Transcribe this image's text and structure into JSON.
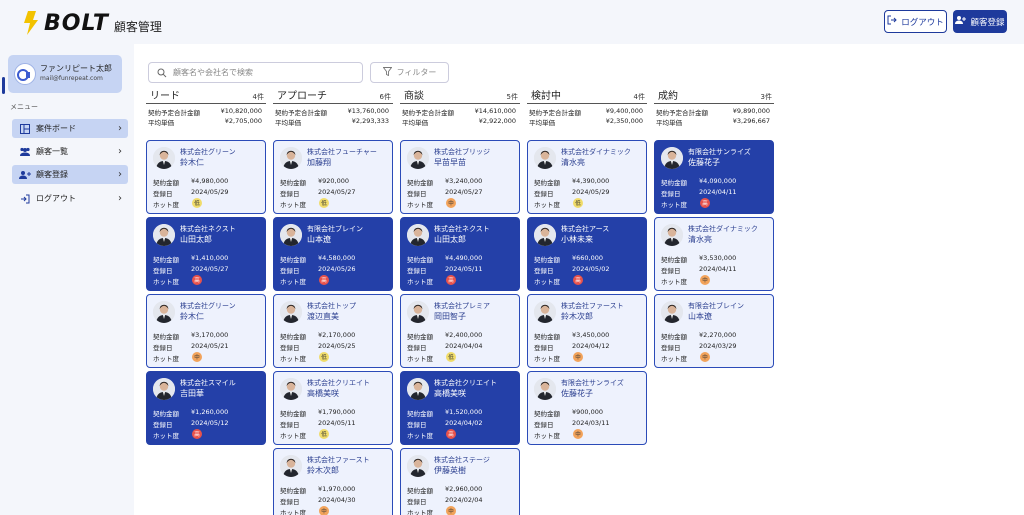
{
  "app": {
    "logo_text": "BOLT",
    "subtitle": "顧客管理"
  },
  "header": {
    "logout_label": "ログアウト",
    "register_label": "顧客登録"
  },
  "user": {
    "name": "ファンリピート太郎",
    "email": "mail@funrepeat.com"
  },
  "sidebar": {
    "menu_label": "メニュー",
    "items": [
      {
        "label": "案件ボード",
        "icon": "board-icon",
        "active": true
      },
      {
        "label": "顧客一覧",
        "icon": "users-icon",
        "active": false
      },
      {
        "label": "顧客登録",
        "icon": "user-add-icon",
        "active": true
      },
      {
        "label": "ログアウト",
        "icon": "logout-icon",
        "active": false
      }
    ]
  },
  "search": {
    "placeholder": "顧客名や会社名で検索"
  },
  "filter": {
    "label": "フィルター"
  },
  "labels": {
    "total": "契約予定合計金額",
    "avg": "平均単価",
    "amount": "契約金額",
    "date": "登録日",
    "hot": "ホット度"
  },
  "colors": {
    "accent": "#2440a8",
    "card_light": "#eef2fd",
    "hot_high": "#e8524b",
    "hot_mid": "#f2a35b",
    "hot_low": "#f0dc6a"
  },
  "columns": [
    {
      "title": "リード",
      "count": "4件",
      "total": "¥10,820,000",
      "avg": "¥2,705,000",
      "cards": [
        {
          "company": "株式会社グリーン",
          "person": "鈴木仁",
          "amount": "¥4,980,000",
          "date": "2024/05/29",
          "hot": "低",
          "dark": false
        },
        {
          "company": "株式会社ネクスト",
          "person": "山田太郎",
          "amount": "¥1,410,000",
          "date": "2024/05/27",
          "hot": "高",
          "dark": true
        },
        {
          "company": "株式会社グリーン",
          "person": "鈴木仁",
          "amount": "¥3,170,000",
          "date": "2024/05/21",
          "hot": "中",
          "dark": false
        },
        {
          "company": "株式会社スマイル",
          "person": "吉田華",
          "amount": "¥1,260,000",
          "date": "2024/05/12",
          "hot": "高",
          "dark": true
        }
      ]
    },
    {
      "title": "アプローチ",
      "count": "6件",
      "total": "¥13,760,000",
      "avg": "¥2,293,333",
      "cards": [
        {
          "company": "株式会社フューチャー",
          "person": "加藤翔",
          "amount": "¥920,000",
          "date": "2024/05/27",
          "hot": "低",
          "dark": false
        },
        {
          "company": "有限会社ブレイン",
          "person": "山本遼",
          "amount": "¥4,580,000",
          "date": "2024/05/26",
          "hot": "高",
          "dark": true
        },
        {
          "company": "株式会社トップ",
          "person": "渡辺直美",
          "amount": "¥2,170,000",
          "date": "2024/05/25",
          "hot": "低",
          "dark": false
        },
        {
          "company": "株式会社クリエイト",
          "person": "高橋美咲",
          "amount": "¥1,790,000",
          "date": "2024/05/11",
          "hot": "低",
          "dark": false
        },
        {
          "company": "株式会社ファースト",
          "person": "鈴木次郎",
          "amount": "¥1,970,000",
          "date": "2024/04/30",
          "hot": "中",
          "dark": false
        }
      ]
    },
    {
      "title": "商談",
      "count": "5件",
      "total": "¥14,610,000",
      "avg": "¥2,922,000",
      "cards": [
        {
          "company": "株式会社ブリッジ",
          "person": "早苗早苗",
          "amount": "¥3,240,000",
          "date": "2024/05/27",
          "hot": "中",
          "dark": false
        },
        {
          "company": "株式会社ネクスト",
          "person": "山田太郎",
          "amount": "¥4,490,000",
          "date": "2024/05/11",
          "hot": "高",
          "dark": true
        },
        {
          "company": "株式会社プレミア",
          "person": "岡田智子",
          "amount": "¥2,400,000",
          "date": "2024/04/04",
          "hot": "低",
          "dark": false
        },
        {
          "company": "株式会社クリエイト",
          "person": "高橋美咲",
          "amount": "¥1,520,000",
          "date": "2024/04/02",
          "hot": "高",
          "dark": true
        },
        {
          "company": "株式会社ステージ",
          "person": "伊藤英樹",
          "amount": "¥2,960,000",
          "date": "2024/02/04",
          "hot": "中",
          "dark": false
        }
      ]
    },
    {
      "title": "検討中",
      "count": "4件",
      "total": "¥9,400,000",
      "avg": "¥2,350,000",
      "cards": [
        {
          "company": "株式会社ダイナミック",
          "person": "清水亮",
          "amount": "¥4,390,000",
          "date": "2024/05/29",
          "hot": "低",
          "dark": false
        },
        {
          "company": "株式会社アース",
          "person": "小林未来",
          "amount": "¥660,000",
          "date": "2024/05/02",
          "hot": "高",
          "dark": true
        },
        {
          "company": "株式会社ファースト",
          "person": "鈴木次郎",
          "amount": "¥3,450,000",
          "date": "2024/04/12",
          "hot": "中",
          "dark": false
        },
        {
          "company": "有限会社サンライズ",
          "person": "佐藤花子",
          "amount": "¥900,000",
          "date": "2024/03/11",
          "hot": "中",
          "dark": false
        }
      ]
    },
    {
      "title": "成約",
      "count": "3件",
      "total": "¥9,890,000",
      "avg": "¥3,296,667",
      "cards": [
        {
          "company": "有限会社サンライズ",
          "person": "佐藤花子",
          "amount": "¥4,090,000",
          "date": "2024/04/11",
          "hot": "高",
          "dark": true
        },
        {
          "company": "株式会社ダイナミック",
          "person": "清水亮",
          "amount": "¥3,530,000",
          "date": "2024/04/11",
          "hot": "中",
          "dark": false
        },
        {
          "company": "有限会社ブレイン",
          "person": "山本遼",
          "amount": "¥2,270,000",
          "date": "2024/03/29",
          "hot": "中",
          "dark": false
        }
      ]
    }
  ]
}
